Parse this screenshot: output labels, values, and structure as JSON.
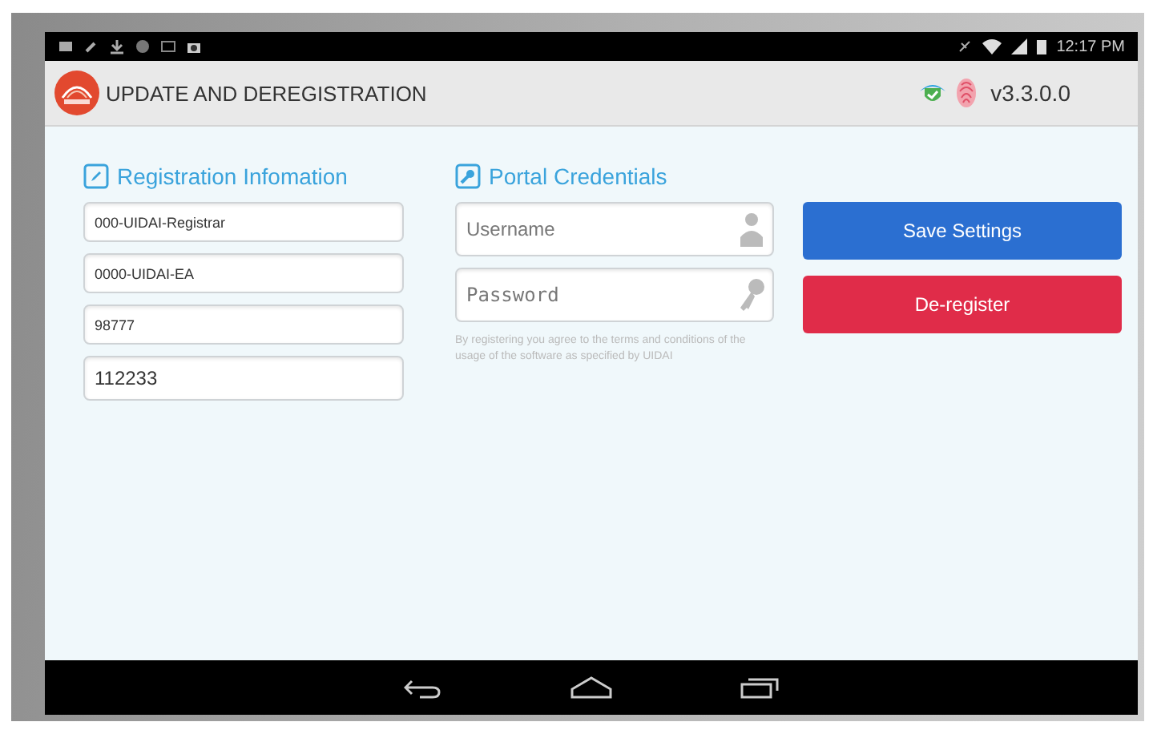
{
  "status_bar": {
    "time": "12:17 PM"
  },
  "header": {
    "title": "UPDATE AND DEREGISTRATION",
    "version": "v3.3.0.0"
  },
  "registration": {
    "heading": "Registration Infomation",
    "fields": [
      {
        "value": "000-UIDAI-Registrar"
      },
      {
        "value": "0000-UIDAI-EA"
      },
      {
        "value": "98777"
      },
      {
        "value": "112233"
      }
    ]
  },
  "credentials": {
    "heading": "Portal Credentials",
    "fields": [
      {
        "kind": "user",
        "placeholder": "Username"
      },
      {
        "kind": "key",
        "placeholder": "Password"
      }
    ],
    "note": "By registering you agree to the terms and conditions of the usage of the software as specified by UIDAI"
  },
  "buttons": [
    {
      "kind": "primary",
      "label": "Save Settings"
    },
    {
      "kind": "danger",
      "label": "De-register"
    }
  ]
}
